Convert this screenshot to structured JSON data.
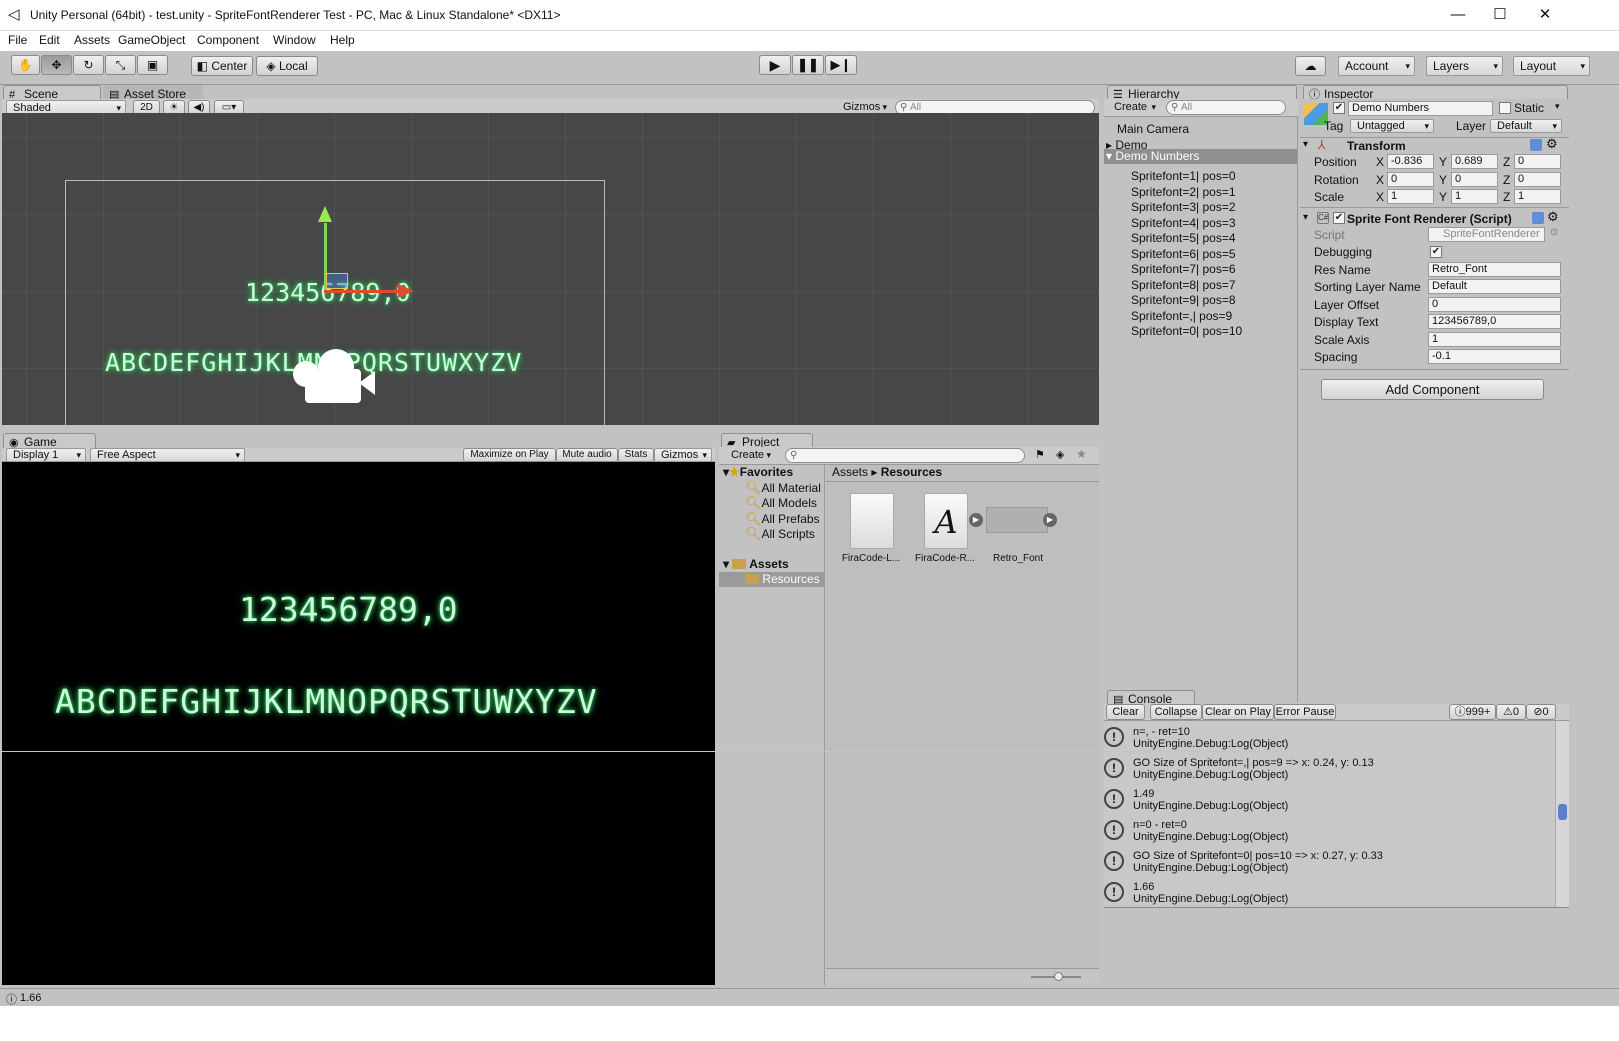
{
  "window": {
    "title": "Unity Personal (64bit) - test.unity - SpriteFontRenderer Test - PC, Mac & Linux Standalone* <DX11>",
    "minimize": "—",
    "maximize": "☐",
    "close": "✕"
  },
  "menu": [
    "File",
    "Edit",
    "Assets",
    "GameObject",
    "Component",
    "Window",
    "Help"
  ],
  "toolbar": {
    "pivot": "Center",
    "space": "Local",
    "account": "Account",
    "layers": "Layers",
    "layout": "Layout"
  },
  "scene": {
    "tab_label": "Scene",
    "asset_store_label": "Asset Store",
    "shading": "Shaded",
    "mode2d": "2D",
    "gizmos": "Gizmos",
    "search_placeholder": "All",
    "digits": "123456789,0",
    "letters": "ABCDEFGHIJKLMNOPQRSTUWXYZV"
  },
  "game": {
    "tab_label": "Game",
    "display": "Display 1",
    "aspect": "Free Aspect",
    "maximize": "Maximize on Play",
    "mute": "Mute audio",
    "stats": "Stats",
    "gizmos": "Gizmos",
    "digits": "123456789,0",
    "letters": "ABCDEFGHIJKLMNOPQRSTUWXYZV"
  },
  "hierarchy": {
    "tab_label": "Hierarchy",
    "create": "Create",
    "search_placeholder": "All",
    "items": [
      "Main Camera",
      "Demo",
      "Demo Numbers"
    ],
    "children": [
      "Spritefont=1| pos=0",
      "Spritefont=2| pos=1",
      "Spritefont=3| pos=2",
      "Spritefont=4| pos=3",
      "Spritefont=5| pos=4",
      "Spritefont=6| pos=5",
      "Spritefont=7| pos=6",
      "Spritefont=8| pos=7",
      "Spritefont=9| pos=8",
      "Spritefont=,| pos=9",
      "Spritefont=0| pos=10"
    ]
  },
  "inspector": {
    "tab_label": "Inspector",
    "object_name": "Demo Numbers",
    "static_label": "Static",
    "tag_label": "Tag",
    "tag_value": "Untagged",
    "layer_label": "Layer",
    "layer_value": "Default",
    "transform_title": "Transform",
    "position_label": "Position",
    "rotation_label": "Rotation",
    "scale_label": "Scale",
    "x": "X",
    "y": "Y",
    "z": "Z",
    "position": [
      "-0.836",
      "0.689",
      "0"
    ],
    "rotation": [
      "0",
      "0",
      "0"
    ],
    "scale": [
      "1",
      "1",
      "1"
    ],
    "component_title": "Sprite Font Renderer (Script)",
    "props": [
      {
        "label": "Script",
        "value": "SpriteFontRenderer"
      },
      {
        "label": "Debugging",
        "value": ""
      },
      {
        "label": "Res Name",
        "value": "Retro_Font"
      },
      {
        "label": "Sorting Layer Name",
        "value": "Default"
      },
      {
        "label": "Layer Offset",
        "value": "0"
      },
      {
        "label": "Display Text",
        "value": "123456789,0"
      },
      {
        "label": "Scale Axis",
        "value": "1"
      },
      {
        "label": "Spacing",
        "value": "-0.1"
      }
    ],
    "add_component": "Add Component"
  },
  "project": {
    "tab_label": "Project",
    "create": "Create",
    "favorites": "Favorites",
    "fav_items": [
      "All Material",
      "All Models",
      "All Prefabs",
      "All Scripts"
    ],
    "assets": "Assets",
    "resources": "Resources",
    "breadcrumb": [
      "Assets",
      "Resources"
    ],
    "files": [
      "FiraCode-L...",
      "FiraCode-R...",
      "Retro_Font"
    ]
  },
  "console": {
    "tab_label": "Console",
    "clear": "Clear",
    "collapse": "Collapse",
    "clear_on_play": "Clear on Play",
    "error_pause": "Error Pause",
    "log_count": "999+",
    "warn_count": "0",
    "error_count": "0",
    "entries": [
      {
        "l1": "n=, - ret=10",
        "l2": "UnityEngine.Debug:Log(Object)"
      },
      {
        "l1": "GO Size of Spritefont=,| pos=9 => x: 0.24, y: 0.13",
        "l2": "UnityEngine.Debug:Log(Object)"
      },
      {
        "l1": "1.49",
        "l2": "UnityEngine.Debug:Log(Object)"
      },
      {
        "l1": "n=0 - ret=0",
        "l2": "UnityEngine.Debug:Log(Object)"
      },
      {
        "l1": "GO Size of Spritefont=0| pos=10 => x: 0.27, y: 0.33",
        "l2": "UnityEngine.Debug:Log(Object)"
      },
      {
        "l1": "1.66",
        "l2": "UnityEngine.Debug:Log(Object)"
      }
    ]
  },
  "statusbar": {
    "text": "1.66"
  },
  "colors": {
    "accent_selected": "#3e7ce0",
    "glow_text": "#c9ffd6",
    "scene_bg": "#474747"
  }
}
